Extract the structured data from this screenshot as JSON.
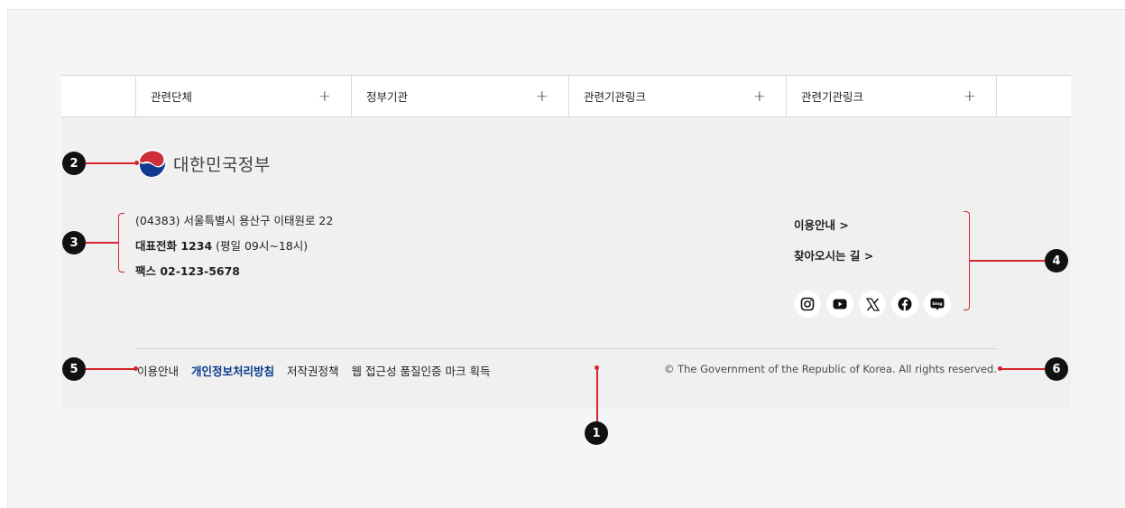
{
  "related": {
    "items": [
      {
        "label": "관련단체",
        "icon": "plus-icon",
        "symbol": "+"
      },
      {
        "label": "정부기관",
        "icon": "plus-icon",
        "symbol": "+"
      },
      {
        "label": "관련기관링크",
        "icon": "plus-icon",
        "symbol": "+"
      },
      {
        "label": "관련기관링크",
        "icon": "plus-icon",
        "symbol": "+"
      }
    ]
  },
  "logo": {
    "text": "대한민국정부",
    "icon": "taegeuk-logo-icon"
  },
  "address": {
    "line1": "(04383) 서울특별시 용산구 이태원로 22",
    "phone_label": "대표전화 1234",
    "phone_hours": " (평일 09시~18시)",
    "fax": "팩스 02-123-5678"
  },
  "right_links": {
    "guide": "이용안내 >",
    "directions": "찾아오시는 길 >"
  },
  "social": [
    "instagram-icon",
    "youtube-icon",
    "x-icon",
    "facebook-icon",
    "blog-icon"
  ],
  "bottom_links": {
    "guide": "이용안내",
    "privacy": "개인정보처리방침",
    "copyright_policy": "저작권정책",
    "accessibility": "웹 접근성 품질인증 마크 획득"
  },
  "copyright": "© The Government of the Republic of Korea. All rights reserved.",
  "annotations": {
    "b1": "1",
    "b2": "2",
    "b3": "3",
    "b4": "4",
    "b5": "5",
    "b6": "6"
  },
  "colors": {
    "accent": "#d6262f",
    "privacy": "#0b3b8c",
    "footer_bg": "#f0f0f0"
  }
}
